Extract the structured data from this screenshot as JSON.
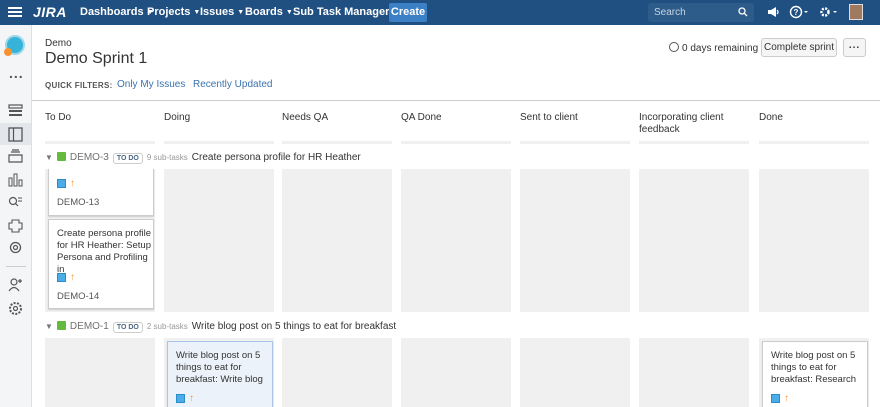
{
  "nav": {
    "logo": "JIRA",
    "menus": [
      "Dashboards",
      "Projects",
      "Issues",
      "Boards",
      "Sub Task Manager"
    ],
    "create_label": "Create",
    "search_placeholder": "Search"
  },
  "sidebar": {
    "icons": [
      "backlog-icon",
      "active-sprint-icon",
      "releases-icon",
      "reports-icon",
      "issues-search-icon",
      "components-icon",
      "settings-gear-icon",
      "add-user-icon",
      "project-settings-icon"
    ],
    "more_label": "..."
  },
  "header": {
    "breadcrumb": "Demo",
    "title": "Demo Sprint 1",
    "remaining": "0 days remaining",
    "complete_label": "Complete sprint",
    "more_label": "...",
    "quick_filters_label": "QUICK FILTERS:",
    "quick_filters": [
      "Only My Issues",
      "Recently Updated"
    ]
  },
  "columns": [
    "To Do",
    "Doing",
    "Needs QA",
    "QA Done",
    "Sent to client",
    "Incorporating client feedback",
    "Done"
  ],
  "swimlanes": [
    {
      "key": "DEMO-3",
      "status": "TO DO",
      "subtasks": "9 sub-tasks",
      "summary": "Create persona profile for HR Heather",
      "cards": [
        {
          "summary": "",
          "key": "DEMO-13"
        },
        {
          "summary": "Create persona profile for HR Heather: Setup Persona and Profiling in",
          "key": "DEMO-14"
        }
      ]
    },
    {
      "key": "DEMO-1",
      "status": "TO DO",
      "subtasks": "2 sub-tasks",
      "summary": "Write blog post on 5 things to eat for breakfast",
      "cards": [
        {
          "summary": "Write blog post on 5 things to eat for breakfast: Write blog"
        },
        {
          "summary": "Write blog post on 5 things to eat for breakfast: Research"
        }
      ]
    }
  ]
}
